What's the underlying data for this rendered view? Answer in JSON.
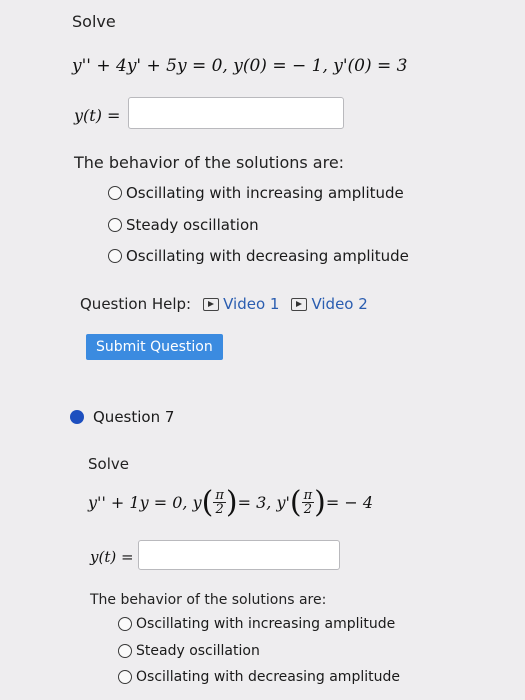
{
  "q6": {
    "solve_label": "Solve",
    "equation": "y'' + 4y' + 5y = 0,  y(0) = − 1,  y'(0) = 3",
    "answer_label": "y(t) =",
    "answer_value": "",
    "behavior_prompt": "The behavior of the solutions are:",
    "options": [
      "Oscillating with increasing amplitude",
      "Steady oscillation",
      "Oscillating with decreasing amplitude"
    ],
    "help_label": "Question Help:",
    "video1": "Video 1",
    "video2": "Video 2",
    "submit_label": "Submit Question"
  },
  "q7": {
    "title": "Question 7",
    "solve_label": "Solve",
    "eq_left": "y'' + 1y = 0,  y",
    "eq_mid": " = 3,  y'",
    "eq_right": " = − 4",
    "frac_num": "π",
    "frac_den": "2",
    "answer_label": "y(t) =",
    "answer_value": "",
    "behavior_prompt": "The behavior of the solutions are:",
    "options": [
      "Oscillating with increasing amplitude",
      "Steady oscillation",
      "Oscillating with decreasing amplitude"
    ]
  }
}
